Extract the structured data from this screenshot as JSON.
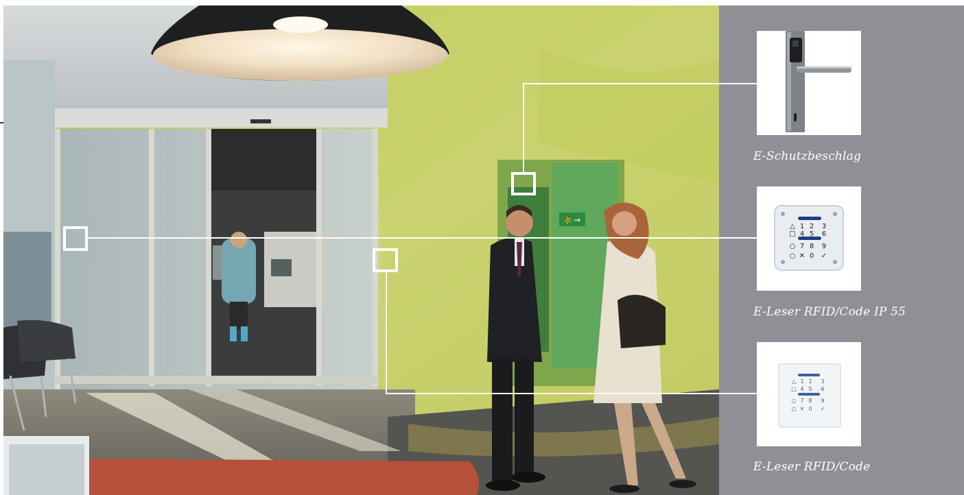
{
  "products": [
    {
      "icon": "door-handle-icon",
      "caption": "E-Schutzbeschlag"
    },
    {
      "icon": "keypad-reader-icon",
      "caption": "E-Leser RFID/Code IP 55"
    },
    {
      "icon": "flush-keypad-reader-icon",
      "caption": "E-Leser RFID/Code"
    }
  ],
  "keypad": {
    "keys": [
      "△",
      "1",
      "2",
      "3",
      "□",
      "4",
      "5",
      "6",
      "○",
      "7",
      "8",
      "9",
      "○",
      "✕",
      "0",
      "✓"
    ]
  },
  "exit_sign": "⛹→",
  "colors": {
    "panel": "#8f9096",
    "wall": "#c9cf6a",
    "callout": "#ffffff",
    "caption": "#ffffff"
  }
}
